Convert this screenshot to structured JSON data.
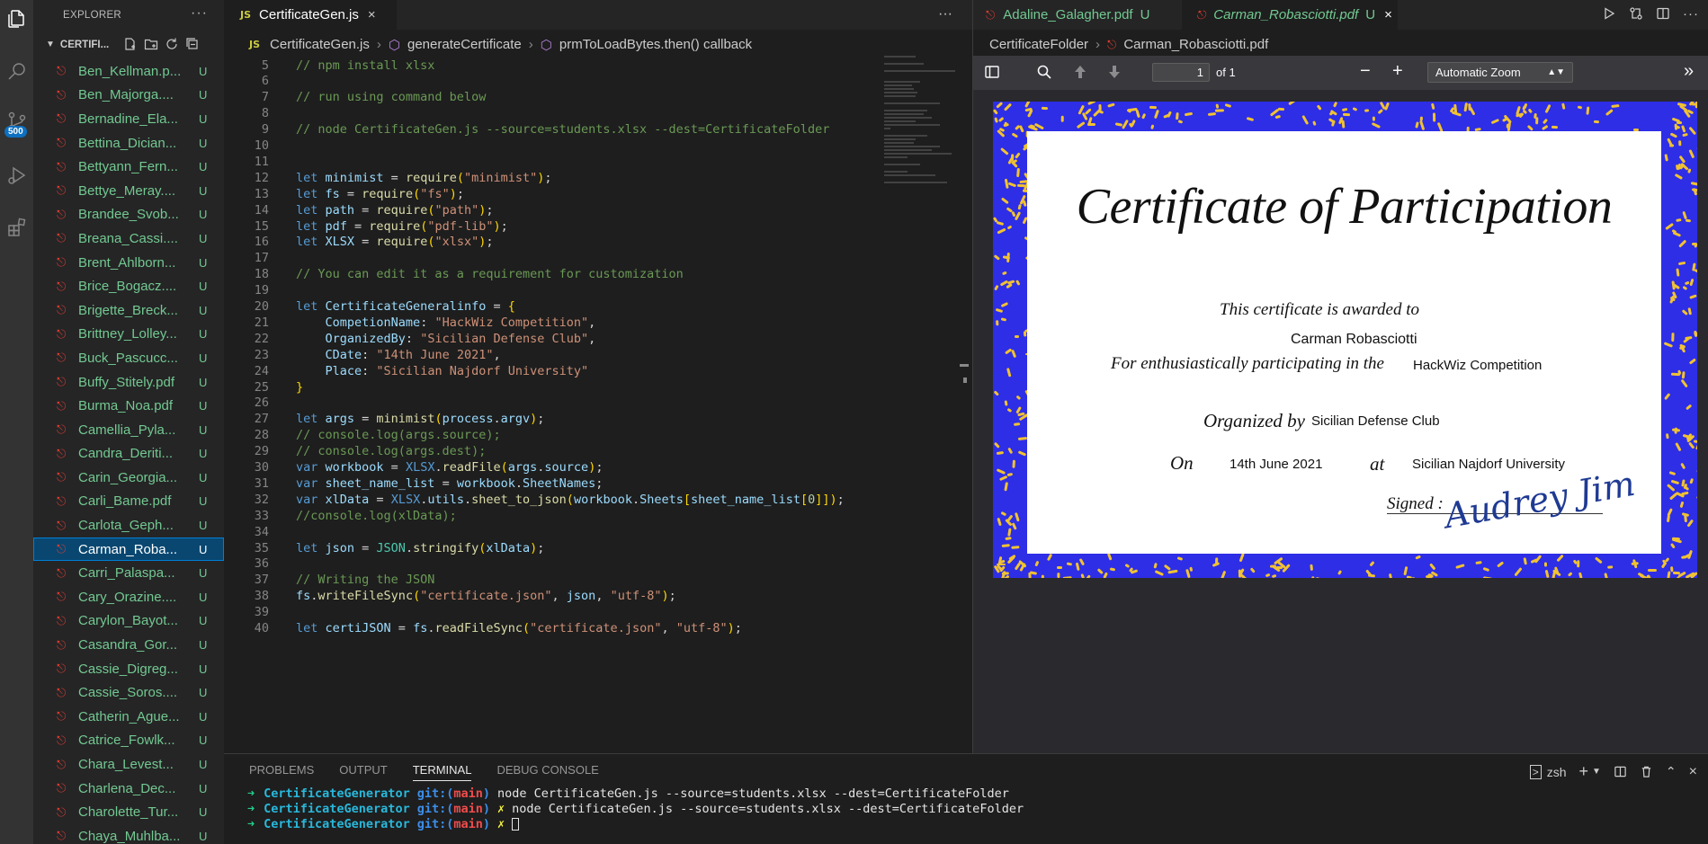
{
  "activity_bar": {
    "badge": "500"
  },
  "explorer": {
    "title": "EXPLORER",
    "more": "···",
    "folder": "CERTIFI...",
    "files": [
      {
        "name": "Ben_Kellman.p...",
        "status": "U"
      },
      {
        "name": "Ben_Majorga....",
        "status": "U"
      },
      {
        "name": "Bernadine_Ela...",
        "status": "U"
      },
      {
        "name": "Bettina_Dician...",
        "status": "U"
      },
      {
        "name": "Bettyann_Fern...",
        "status": "U"
      },
      {
        "name": "Bettye_Meray....",
        "status": "U"
      },
      {
        "name": "Brandee_Svob...",
        "status": "U"
      },
      {
        "name": "Breana_Cassi....",
        "status": "U"
      },
      {
        "name": "Brent_Ahlborn...",
        "status": "U"
      },
      {
        "name": "Brice_Bogacz....",
        "status": "U"
      },
      {
        "name": "Brigette_Breck...",
        "status": "U"
      },
      {
        "name": "Brittney_Lolley...",
        "status": "U"
      },
      {
        "name": "Buck_Pascucc...",
        "status": "U"
      },
      {
        "name": "Buffy_Stitely.pdf",
        "status": "U"
      },
      {
        "name": "Burma_Noa.pdf",
        "status": "U"
      },
      {
        "name": "Camellia_Pyla...",
        "status": "U"
      },
      {
        "name": "Candra_Deriti...",
        "status": "U"
      },
      {
        "name": "Carin_Georgia...",
        "status": "U"
      },
      {
        "name": "Carli_Bame.pdf",
        "status": "U"
      },
      {
        "name": "Carlota_Geph...",
        "status": "U"
      },
      {
        "name": "Carman_Roba...",
        "status": "U"
      },
      {
        "name": "Carri_Palaspa...",
        "status": "U"
      },
      {
        "name": "Cary_Orazine....",
        "status": "U"
      },
      {
        "name": "Carylon_Bayot...",
        "status": "U"
      },
      {
        "name": "Casandra_Gor...",
        "status": "U"
      },
      {
        "name": "Cassie_Digreg...",
        "status": "U"
      },
      {
        "name": "Cassie_Soros....",
        "status": "U"
      },
      {
        "name": "Catherin_Ague...",
        "status": "U"
      },
      {
        "name": "Catrice_Fowlk...",
        "status": "U"
      },
      {
        "name": "Chara_Levest...",
        "status": "U"
      },
      {
        "name": "Charlena_Dec...",
        "status": "U"
      },
      {
        "name": "Charolette_Tur...",
        "status": "U"
      },
      {
        "name": "Chaya_Muhlba...",
        "status": "U"
      }
    ],
    "selected_index": 20
  },
  "editor": {
    "tab": {
      "icon": "JS",
      "label": "CertificateGen.js",
      "close": "×"
    },
    "more": "···",
    "breadcrumb": {
      "file": "CertificateGen.js",
      "function": "generateCertificate",
      "callback": "prmToLoadBytes.then() callback"
    },
    "lines": [
      {
        "n": "5",
        "spans": [
          [
            "c-com",
            "// npm install xlsx"
          ]
        ]
      },
      {
        "n": "6",
        "spans": []
      },
      {
        "n": "7",
        "spans": [
          [
            "c-com",
            "// run using command below"
          ]
        ]
      },
      {
        "n": "8",
        "spans": []
      },
      {
        "n": "9",
        "spans": [
          [
            "c-com",
            "// node CertificateGen.js --source=students.xlsx --dest=CertificateFolder"
          ]
        ]
      },
      {
        "n": "10",
        "spans": []
      },
      {
        "n": "11",
        "spans": []
      },
      {
        "n": "12",
        "spans": [
          [
            "c-kw",
            "let "
          ],
          [
            "c-var",
            "minimist"
          ],
          [
            "c-pun",
            " = "
          ],
          [
            "c-fn",
            "require"
          ],
          [
            "c-br",
            "("
          ],
          [
            "c-str",
            "\"minimist\""
          ],
          [
            "c-br",
            ")"
          ],
          [
            "c-pun",
            ";"
          ]
        ]
      },
      {
        "n": "13",
        "spans": [
          [
            "c-kw",
            "let "
          ],
          [
            "c-var",
            "fs"
          ],
          [
            "c-pun",
            " = "
          ],
          [
            "c-fn",
            "require"
          ],
          [
            "c-br",
            "("
          ],
          [
            "c-str",
            "\"fs\""
          ],
          [
            "c-br",
            ")"
          ],
          [
            "c-pun",
            ";"
          ]
        ]
      },
      {
        "n": "14",
        "spans": [
          [
            "c-kw",
            "let "
          ],
          [
            "c-var",
            "path"
          ],
          [
            "c-pun",
            " = "
          ],
          [
            "c-fn",
            "require"
          ],
          [
            "c-br",
            "("
          ],
          [
            "c-str",
            "\"path\""
          ],
          [
            "c-br",
            ")"
          ],
          [
            "c-pun",
            ";"
          ]
        ]
      },
      {
        "n": "15",
        "spans": [
          [
            "c-kw",
            "let "
          ],
          [
            "c-var",
            "pdf"
          ],
          [
            "c-pun",
            " = "
          ],
          [
            "c-fn",
            "require"
          ],
          [
            "c-br",
            "("
          ],
          [
            "c-str",
            "\"pdf-lib\""
          ],
          [
            "c-br",
            ")"
          ],
          [
            "c-pun",
            ";"
          ]
        ]
      },
      {
        "n": "16",
        "spans": [
          [
            "c-kw",
            "let "
          ],
          [
            "c-var",
            "XLSX"
          ],
          [
            "c-pun",
            " = "
          ],
          [
            "c-fn",
            "require"
          ],
          [
            "c-br",
            "("
          ],
          [
            "c-str",
            "\"xlsx\""
          ],
          [
            "c-br",
            ")"
          ],
          [
            "c-pun",
            ";"
          ]
        ]
      },
      {
        "n": "17",
        "spans": []
      },
      {
        "n": "18",
        "spans": [
          [
            "c-com",
            "// You can edit it as a requirement for customization"
          ]
        ]
      },
      {
        "n": "19",
        "spans": []
      },
      {
        "n": "20",
        "spans": [
          [
            "c-kw",
            "let "
          ],
          [
            "c-var",
            "CertificateGeneralinfo"
          ],
          [
            "c-pun",
            " = "
          ],
          [
            "c-br",
            "{"
          ]
        ]
      },
      {
        "n": "21",
        "spans": [
          [
            "c-pun",
            "    "
          ],
          [
            "c-var",
            "CompetionName"
          ],
          [
            "c-pun",
            ": "
          ],
          [
            "c-str",
            "\"HackWiz Competition\""
          ],
          [
            "c-pun",
            ","
          ]
        ]
      },
      {
        "n": "22",
        "spans": [
          [
            "c-pun",
            "    "
          ],
          [
            "c-var",
            "OrganizedBy"
          ],
          [
            "c-pun",
            ": "
          ],
          [
            "c-str",
            "\"Sicilian Defense Club\""
          ],
          [
            "c-pun",
            ","
          ]
        ]
      },
      {
        "n": "23",
        "spans": [
          [
            "c-pun",
            "    "
          ],
          [
            "c-var",
            "CDate"
          ],
          [
            "c-pun",
            ": "
          ],
          [
            "c-str",
            "\"14th June 2021\""
          ],
          [
            "c-pun",
            ","
          ]
        ]
      },
      {
        "n": "24",
        "spans": [
          [
            "c-pun",
            "    "
          ],
          [
            "c-var",
            "Place"
          ],
          [
            "c-pun",
            ": "
          ],
          [
            "c-str",
            "\"Sicilian Najdorf University\""
          ]
        ]
      },
      {
        "n": "25",
        "spans": [
          [
            "c-br",
            "}"
          ]
        ]
      },
      {
        "n": "26",
        "spans": []
      },
      {
        "n": "27",
        "spans": [
          [
            "c-kw",
            "let "
          ],
          [
            "c-var",
            "args"
          ],
          [
            "c-pun",
            " = "
          ],
          [
            "c-fn",
            "minimist"
          ],
          [
            "c-br",
            "("
          ],
          [
            "c-var",
            "process"
          ],
          [
            "c-pun",
            "."
          ],
          [
            "c-var",
            "argv"
          ],
          [
            "c-br",
            ")"
          ],
          [
            "c-pun",
            ";"
          ]
        ]
      },
      {
        "n": "28",
        "spans": [
          [
            "c-com",
            "// console.log(args.source);"
          ]
        ]
      },
      {
        "n": "29",
        "spans": [
          [
            "c-com",
            "// console.log(args.dest);"
          ]
        ]
      },
      {
        "n": "30",
        "spans": [
          [
            "c-kw",
            "var "
          ],
          [
            "c-var",
            "workbook"
          ],
          [
            "c-pun",
            " = "
          ],
          [
            "c-kw",
            "XLSX"
          ],
          [
            "c-pun",
            "."
          ],
          [
            "c-fn",
            "readFile"
          ],
          [
            "c-br",
            "("
          ],
          [
            "c-var",
            "args"
          ],
          [
            "c-pun",
            "."
          ],
          [
            "c-var",
            "source"
          ],
          [
            "c-br",
            ")"
          ],
          [
            "c-pun",
            ";"
          ]
        ]
      },
      {
        "n": "31",
        "spans": [
          [
            "c-kw",
            "var "
          ],
          [
            "c-var",
            "sheet_name_list"
          ],
          [
            "c-pun",
            " = "
          ],
          [
            "c-var",
            "workbook"
          ],
          [
            "c-pun",
            "."
          ],
          [
            "c-var",
            "SheetNames"
          ],
          [
            "c-pun",
            ";"
          ]
        ]
      },
      {
        "n": "32",
        "spans": [
          [
            "c-kw",
            "var "
          ],
          [
            "c-var",
            "xlData"
          ],
          [
            "c-pun",
            " = "
          ],
          [
            "c-kw",
            "XLSX"
          ],
          [
            "c-pun",
            "."
          ],
          [
            "c-var",
            "utils"
          ],
          [
            "c-pun",
            "."
          ],
          [
            "c-fn",
            "sheet_to_json"
          ],
          [
            "c-br",
            "("
          ],
          [
            "c-var",
            "workbook"
          ],
          [
            "c-pun",
            "."
          ],
          [
            "c-var",
            "Sheets"
          ],
          [
            "c-br",
            "["
          ],
          [
            "c-var",
            "sheet_name_list"
          ],
          [
            "c-br",
            "["
          ],
          [
            "c-num",
            "0"
          ],
          [
            "c-br",
            "]]"
          ],
          [
            "c-br",
            ")"
          ],
          [
            "c-pun",
            ";"
          ]
        ]
      },
      {
        "n": "33",
        "spans": [
          [
            "c-com",
            "//console.log(xlData);"
          ]
        ]
      },
      {
        "n": "34",
        "spans": []
      },
      {
        "n": "35",
        "spans": [
          [
            "c-kw",
            "let "
          ],
          [
            "c-var",
            "json"
          ],
          [
            "c-pun",
            " = "
          ],
          [
            "c-cls",
            "JSON"
          ],
          [
            "c-pun",
            "."
          ],
          [
            "c-fn",
            "stringify"
          ],
          [
            "c-br",
            "("
          ],
          [
            "c-var",
            "xlData"
          ],
          [
            "c-br",
            ")"
          ],
          [
            "c-pun",
            ";"
          ]
        ]
      },
      {
        "n": "36",
        "spans": []
      },
      {
        "n": "37",
        "spans": [
          [
            "c-com",
            "// Writing the JSON"
          ]
        ]
      },
      {
        "n": "38",
        "spans": [
          [
            "c-var",
            "fs"
          ],
          [
            "c-pun",
            "."
          ],
          [
            "c-fn",
            "writeFileSync"
          ],
          [
            "c-br",
            "("
          ],
          [
            "c-str",
            "\"certificate.json\""
          ],
          [
            "c-pun",
            ", "
          ],
          [
            "c-var",
            "json"
          ],
          [
            "c-pun",
            ", "
          ],
          [
            "c-str",
            "\"utf-8\""
          ],
          [
            "c-br",
            ")"
          ],
          [
            "c-pun",
            ";"
          ]
        ]
      },
      {
        "n": "39",
        "spans": []
      },
      {
        "n": "40",
        "spans": [
          [
            "c-kw",
            "let "
          ],
          [
            "c-var",
            "certiJSON"
          ],
          [
            "c-pun",
            " = "
          ],
          [
            "c-var",
            "fs"
          ],
          [
            "c-pun",
            "."
          ],
          [
            "c-fn",
            "readFileSync"
          ],
          [
            "c-br",
            "("
          ],
          [
            "c-str",
            "\"certificate.json\""
          ],
          [
            "c-pun",
            ", "
          ],
          [
            "c-str",
            "\"utf-8\""
          ],
          [
            "c-br",
            ")"
          ],
          [
            "c-pun",
            ";"
          ]
        ]
      }
    ]
  },
  "pdf_viewer": {
    "tabs": [
      {
        "label": "Adaline_Galagher.pdf",
        "status": "U"
      },
      {
        "label": "Carman_Robasciotti.pdf",
        "status": "U",
        "close": "×"
      }
    ],
    "breadcrumb": {
      "folder": "CertificateFolder",
      "file": "Carman_Robasciotti.pdf"
    },
    "page_number": "1",
    "page_total": "of 1",
    "zoom": "Automatic Zoom",
    "certificate": {
      "title": "Certificate of Participation",
      "awarded_to_label": "This certificate is awarded to",
      "name": "Carman Robasciotti",
      "participating_label": "For enthusiastically participating in the",
      "competition": "HackWiz Competition",
      "organized_label": "Organized by",
      "organizer": "Sicilian Defense Club",
      "on_label": "On",
      "date": "14th June 2021",
      "at_label": "at",
      "place": "Sicilian Najdorf University",
      "signed_label": "Signed :",
      "signature": "Audrey Jim"
    }
  },
  "panel": {
    "tabs": [
      "PROBLEMS",
      "OUTPUT",
      "TERMINAL",
      "DEBUG CONSOLE"
    ],
    "active_tab": "TERMINAL",
    "shell": "zsh",
    "terminal": [
      {
        "arrow": "➜",
        "dir": "CertificateGenerator",
        "git": "git:(",
        "branch": "main",
        "git_end": ")",
        "dirty": "",
        "cmd": "node CertificateGen.js --source=students.xlsx --dest=CertificateFolder"
      },
      {
        "arrow": "➜",
        "dir": "CertificateGenerator",
        "git": "git:(",
        "branch": "main",
        "git_end": ")",
        "dirty": "✗",
        "cmd": "node CertificateGen.js --source=students.xlsx --dest=CertificateFolder"
      },
      {
        "arrow": "➜",
        "dir": "CertificateGenerator",
        "git": "git:(",
        "branch": "main",
        "git_end": ")",
        "dirty": "✗",
        "cmd": ""
      }
    ]
  }
}
